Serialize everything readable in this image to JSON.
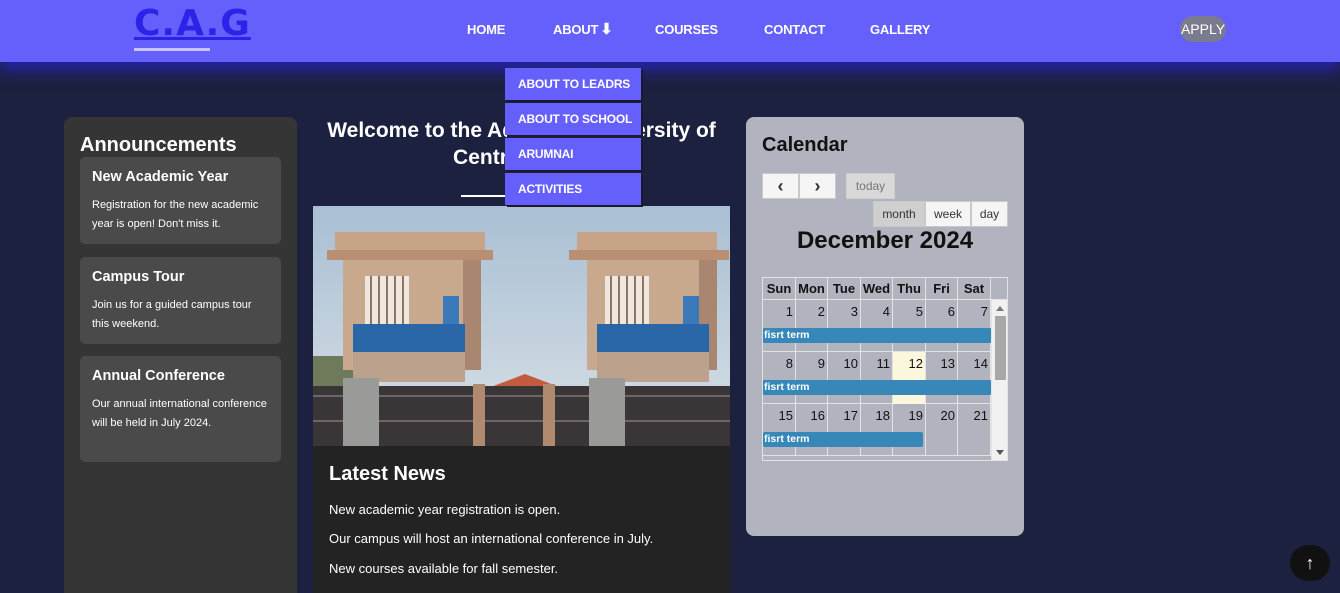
{
  "header": {
    "logo": "C.A.G",
    "nav": [
      "HOME",
      "ABOUT",
      "COURSES",
      "CONTACT",
      "GALLERY"
    ],
    "about_arrow": "⬇",
    "apply": "APPLY"
  },
  "about_dropdown": [
    "ABOUT TO LEADRS",
    "ABOUT TO SCHOOL",
    "ARUMNAI",
    "ACTIVITIES"
  ],
  "announcements": {
    "title": "Announcements",
    "items": [
      {
        "title": "New Academic Year",
        "text": "Registration for the new academic year is open! Don't miss it."
      },
      {
        "title": "Campus Tour",
        "text": "Join us for a guided campus tour this weekend."
      },
      {
        "title": "Annual Conference",
        "text": "Our annual international conference will be held in July 2024."
      }
    ]
  },
  "welcome": {
    "line1": "Welcome to the Adventist University of",
    "line2": "Central Africa"
  },
  "latest_news": {
    "title": "Latest News",
    "items": [
      "New academic year registration is open.",
      "Our campus will host an international conference in July.",
      "New courses available for fall semester."
    ]
  },
  "calendar": {
    "title": "Calendar",
    "prev": "‹",
    "next": "›",
    "today": "today",
    "views": [
      "month",
      "week",
      "day"
    ],
    "active_view": "month",
    "month_label": "December 2024",
    "days_of_week": [
      "Sun",
      "Mon",
      "Tue",
      "Wed",
      "Thu",
      "Fri",
      "Sat"
    ],
    "weeks": [
      [
        "1",
        "2",
        "3",
        "4",
        "5",
        "6",
        "7"
      ],
      [
        "8",
        "9",
        "10",
        "11",
        "12",
        "13",
        "14"
      ],
      [
        "15",
        "16",
        "17",
        "18",
        "19",
        "20",
        "21"
      ]
    ],
    "today_date": "12",
    "event_label": "fisrt term"
  },
  "back_to_top": "↑",
  "colors": {
    "navbar": "#6560fc",
    "logo": "#2d23e8",
    "background": "#1d2140",
    "event": "#3788b8",
    "today_highlight": "#fbf7dc"
  }
}
